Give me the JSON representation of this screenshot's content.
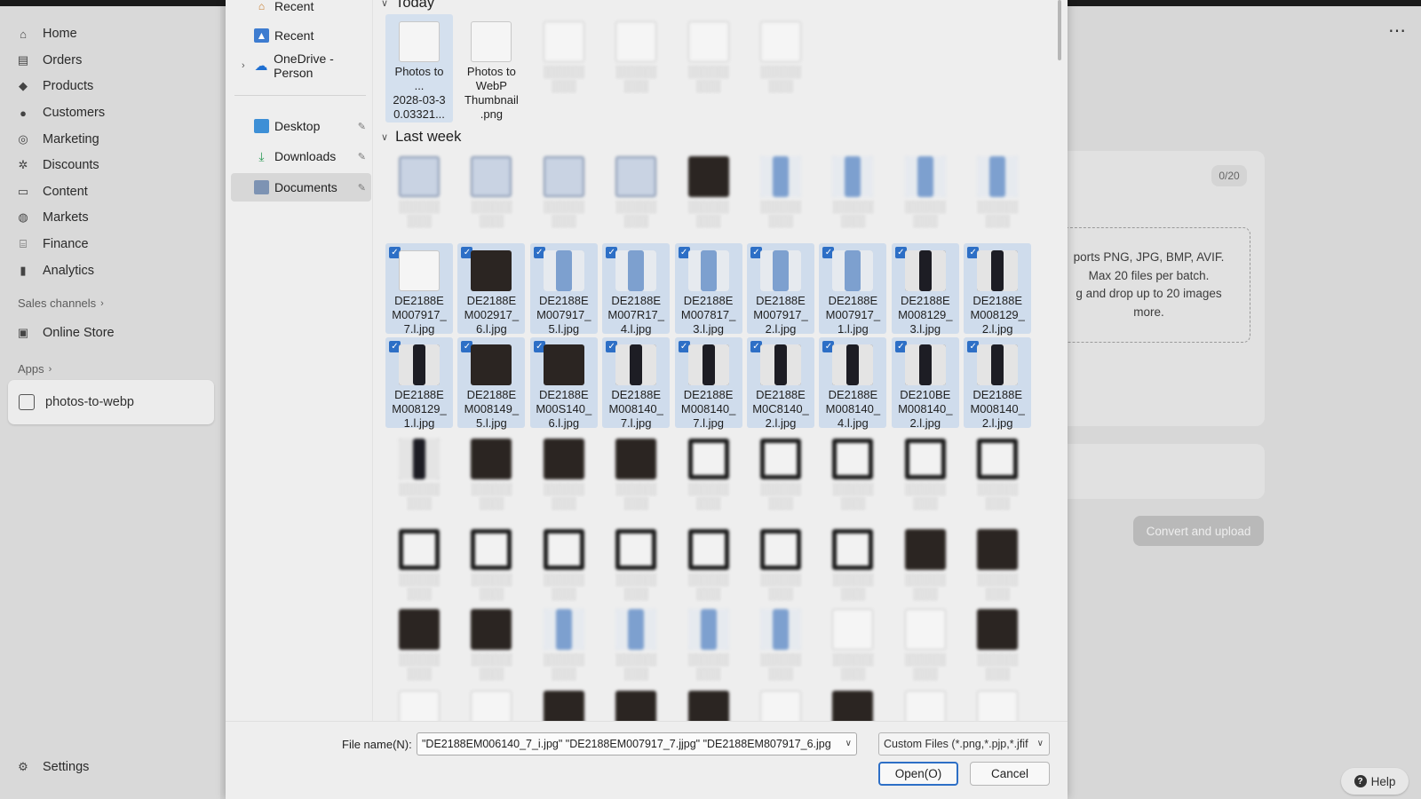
{
  "admin_nav": {
    "items": [
      {
        "label": "Home",
        "icon": "home-icon"
      },
      {
        "label": "Orders",
        "icon": "orders-icon"
      },
      {
        "label": "Products",
        "icon": "tag-icon"
      },
      {
        "label": "Customers",
        "icon": "person-icon"
      },
      {
        "label": "Marketing",
        "icon": "target-icon"
      },
      {
        "label": "Discounts",
        "icon": "gear-badge-icon"
      },
      {
        "label": "Content",
        "icon": "content-icon"
      },
      {
        "label": "Markets",
        "icon": "globe-icon"
      },
      {
        "label": "Finance",
        "icon": "bank-icon"
      },
      {
        "label": "Analytics",
        "icon": "bar-chart-icon"
      }
    ],
    "sales_channels_label": "Sales channels",
    "online_store_label": "Online Store",
    "apps_label": "Apps",
    "active_app_label": "photos-to-webp",
    "settings_label": "Settings"
  },
  "background_app": {
    "counter": "0/20",
    "dropzone_lines": [
      "ports PNG, JPG, BMP, AVIF.",
      "Max 20 files per batch.",
      "g and drop up to 20 images",
      "more."
    ],
    "convert_label": "Convert and upload",
    "help_label": "Help"
  },
  "dialog": {
    "nav_pane": [
      {
        "label": "Recent",
        "icon": "home-icon"
      },
      {
        "label": "Recent",
        "icon": "gallery-icon"
      },
      {
        "label": "OneDrive - Person",
        "icon": "cloud-icon"
      },
      {
        "label": "Desktop",
        "icon": "desktop-icon"
      },
      {
        "label": "Downloads",
        "icon": "download-icon"
      },
      {
        "label": "Documents",
        "icon": "document-icon"
      }
    ],
    "groups": {
      "today": "Today",
      "last_week": "Last week"
    },
    "today_files": [
      {
        "caption": "Photos to\n...\n2028-03-3\n0.03321...",
        "selected": true
      },
      {
        "caption": "Photos to\nWebP\nThumbnail\n.png",
        "selected": false
      },
      {
        "caption": "",
        "selected": false
      },
      {
        "caption": "",
        "selected": false
      },
      {
        "caption": "",
        "selected": false
      },
      {
        "caption": "",
        "selected": false
      }
    ],
    "selected_row_1": [
      "DE2188E\nM007917_\n7.l.jpg",
      "DE2188E\nM002917_\n6.l.jpg",
      "DE2188E\nM007917_\n5.l.jpg",
      "DE2188E\nM007R17_\n4.l.jpg",
      "DE2188E\nM007817_\n3.l.jpg",
      "DE2188E\nM007917_\n2.l.jpg",
      "DE2188E\nM007917_\n1.l.jpg",
      "DE2188E\nM008129_\n3.l.jpg",
      "DE2188E\nM008129_\n2.l.jpg"
    ],
    "selected_row_2": [
      "DE2188E\nM008129_\n1.l.jpg",
      "DE2188E\nM008149_\n5.l.jpg",
      "DE2188E\nM00S140_\n6.l.jpg",
      "DE2188E\nM008140_\n7.l.jpg",
      "DE2188E\nM008140_\n7.l.jpg",
      "DE2188E\nM0C8140_\n2.l.jpg",
      "DE2188E\nM008140_\n4.l.jpg",
      "DE210BE\nM008140_\n2.l.jpg",
      "DE2188E\nM008140_\n2.l.jpg"
    ],
    "file_name_label": "File name(N):",
    "file_name_value": "\"DE2188EM006140_7_i.jpg\" \"DE2188EM007917_7.jjpg\" \"DE2188EM807917_6.jpg",
    "file_type_value": "Custom Files (*.png,*.pjp,*.jfif",
    "open_label": "Open(O)",
    "cancel_label": "Cancel"
  }
}
